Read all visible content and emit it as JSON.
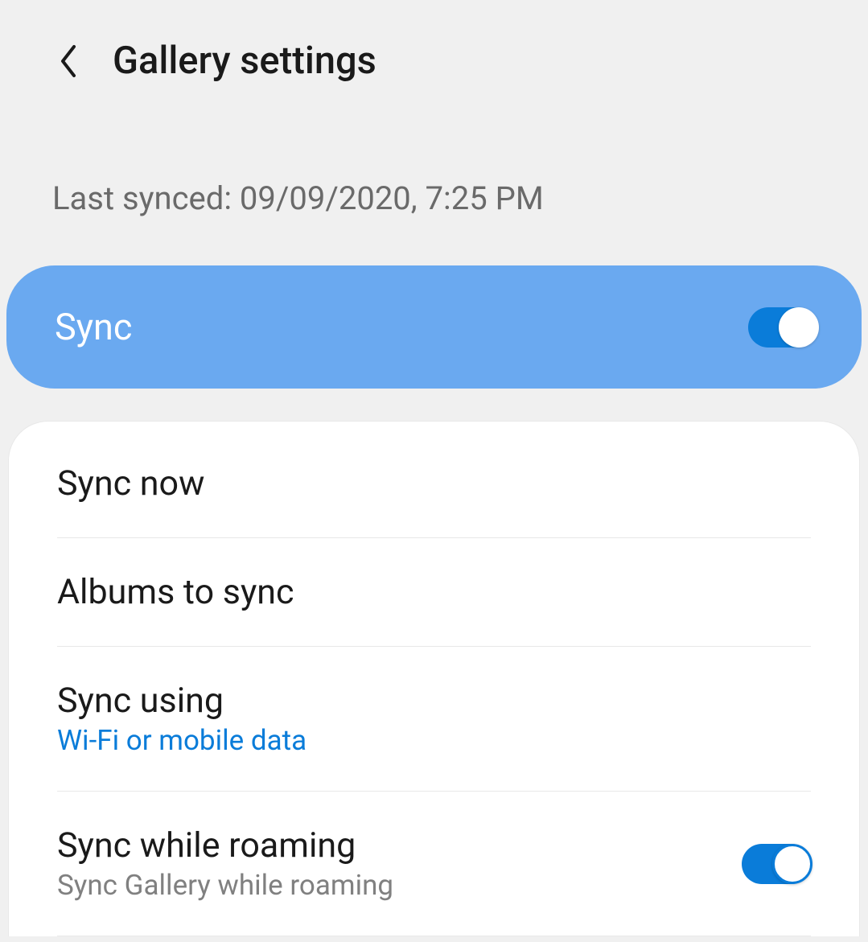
{
  "header": {
    "title": "Gallery settings"
  },
  "lastSynced": "Last synced: 09/09/2020, 7:25 PM",
  "syncCard": {
    "label": "Sync",
    "enabled": true
  },
  "options": [
    {
      "title": "Sync now"
    },
    {
      "title": "Albums to sync"
    },
    {
      "title": "Sync using",
      "subtitle": "Wi-Fi or mobile data",
      "subtitleAccent": true
    },
    {
      "title": "Sync while roaming",
      "subtitle": "Sync Gallery while roaming",
      "toggle": true,
      "toggleEnabled": true
    }
  ]
}
